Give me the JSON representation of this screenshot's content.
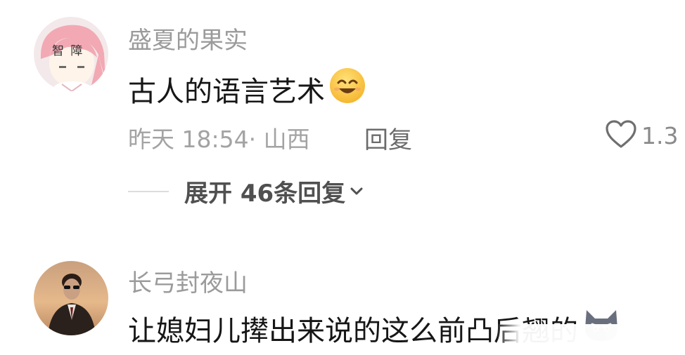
{
  "comments": [
    {
      "username": "盛夏的果实",
      "avatar_text": "智 障",
      "content": "古人的语言艺术",
      "emoji": "smiling-face-emoji",
      "time": "昨天 18:54",
      "location": "山西",
      "reply_label": "回复",
      "like_count": "1.3"
    },
    {
      "username": "长弓封夜山",
      "content": "让媳妇儿撵出来说的这么前凸后翘的",
      "emoji": "angry-cat-emoji"
    }
  ],
  "expand": {
    "label": "展开 46条回复"
  },
  "colors": {
    "username": "#9b9b9b",
    "content": "#161616",
    "meta": "#a3a3a3",
    "reply": "#6b6b6b",
    "expand": "#505050"
  }
}
